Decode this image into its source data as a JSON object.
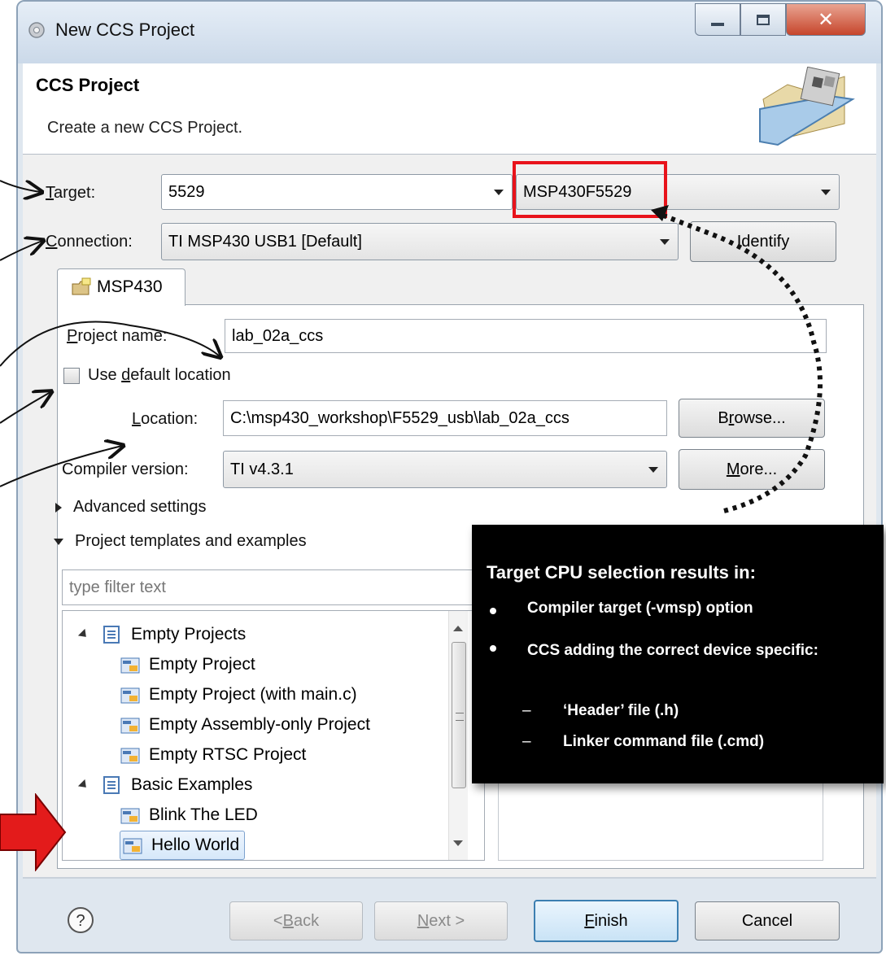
{
  "window": {
    "title": "New CCS Project",
    "header_title": "CCS Project",
    "header_desc": "Create a new CCS Project."
  },
  "form": {
    "target_label": "Target:",
    "target_value": "5529",
    "device_value": "MSP430F5529",
    "connection_label": "Connection:",
    "connection_value": "TI MSP430 USB1 [Default]",
    "identify_button": "Identify",
    "tab_label": "MSP430",
    "project_name_label": "Project name:",
    "project_name_value": "lab_02a_ccs",
    "use_default_location_label": "Use default location",
    "use_default_location_checked": false,
    "location_label": "Location:",
    "location_value": "C:\\msp430_workshop\\F5529_usb\\lab_02a_ccs",
    "browse_button": "Browse...",
    "compiler_label": "Compiler version:",
    "compiler_value": "TI v4.3.1",
    "more_button": "More...",
    "advanced_settings": "Advanced settings",
    "templates_section": "Project templates and examples",
    "filter_placeholder": "type filter text"
  },
  "tree": {
    "groups": [
      {
        "label": "Empty Projects",
        "items": [
          "Empty Project",
          "Empty Project (with main.c)",
          "Empty Assembly-only Project",
          "Empty RTSC Project"
        ]
      },
      {
        "label": "Basic Examples",
        "items": [
          "Blink The LED",
          "Hello World"
        ]
      }
    ],
    "selected": "Hello World"
  },
  "footer": {
    "back_button": "< Back",
    "next_button": "Next >",
    "finish_button": "Finish",
    "cancel_button": "Cancel"
  },
  "callout": {
    "title": "Target CPU selection results in:",
    "bullets": [
      "Compiler target (-vmsp) option",
      "CCS adding the correct device specific:"
    ],
    "sub_bullets": [
      "‘Header’ file (.h)",
      "Linker command file (.cmd)"
    ]
  },
  "colors": {
    "highlight_box": "#e8131b",
    "arrow_red": "#e31b1b",
    "default_button_border": "#3c7fb1",
    "callout_bg": "#000000"
  },
  "icons": [
    "app-icon",
    "folder-cube-icon",
    "tab-project-icon",
    "project-group-icon",
    "project-template-icon",
    "help-icon"
  ]
}
